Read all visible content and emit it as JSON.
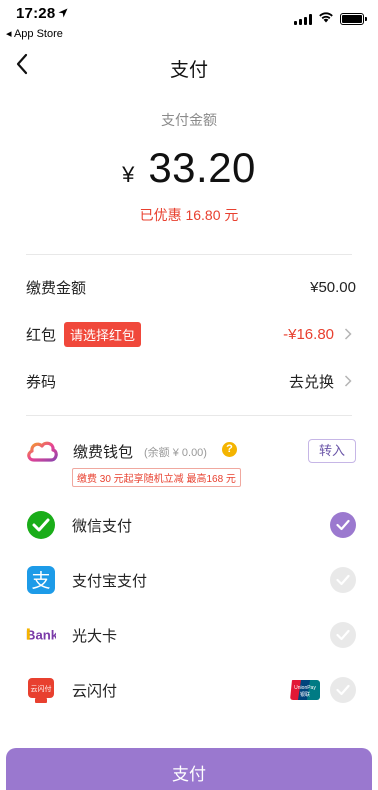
{
  "status_bar": {
    "time": "17:28",
    "location_arrow": "➤",
    "back_app": "◂ App Store"
  },
  "nav": {
    "title": "支付"
  },
  "amount": {
    "label": "支付金额",
    "currency": "¥",
    "value": "33.20",
    "discount": "已优惠 16.80 元"
  },
  "fee_rows": {
    "fee_label": "缴费金额",
    "fee_value": "¥50.00",
    "redpacket_label": "红包",
    "redpacket_tag": "请选择红包",
    "redpacket_value": "-¥16.80",
    "coupon_label": "券码",
    "coupon_value": "去兑换"
  },
  "wallet": {
    "title": "缴费钱包",
    "balance": "(余额 ¥ 0.00)",
    "help": "?",
    "promo": "缴费 30 元起享随机立减 最高168 元",
    "transfer_label": "转入"
  },
  "payment_methods": [
    {
      "label": "微信支付",
      "icon": "wechat-pay-icon",
      "selected": true
    },
    {
      "label": "支付宝支付",
      "icon": "alipay-icon",
      "selected": false
    },
    {
      "label": "光大卡",
      "icon": "everbright-bank-icon",
      "brand_text": "Bank",
      "selected": false
    },
    {
      "label": "云闪付",
      "icon": "cloud-quickpass-icon",
      "brand_text": "云闪付",
      "selected": false,
      "badge": "UnionPay 银联"
    }
  ],
  "pay_button": {
    "label": "支付"
  },
  "colors": {
    "accent": "#9a78cf",
    "discount_red": "#e8402f",
    "wechat_green": "#1aad19",
    "alipay_blue": "#1d9be8"
  }
}
